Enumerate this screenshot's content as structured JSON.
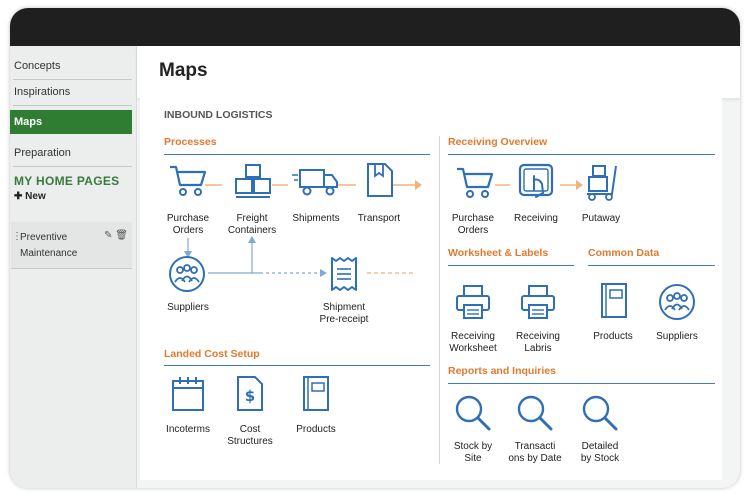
{
  "sidebar": {
    "items": [
      {
        "label": "Concepts"
      },
      {
        "label": "Inspirations"
      },
      {
        "label": "Maps"
      },
      {
        "label": "Preparation"
      }
    ],
    "home_title": "MY HOME PAGES",
    "new_label": "New",
    "pages": [
      {
        "line1": "Preventive",
        "line2": "Maintenance"
      }
    ]
  },
  "header": {
    "title": "Maps"
  },
  "main": {
    "group_title": "INBOUND LOGISTICS",
    "processes": {
      "title": "Processes",
      "items": [
        {
          "line1": "Purchase",
          "line2": "Orders"
        },
        {
          "line1": "Freight",
          "line2": "Containers"
        },
        {
          "line1": "Shipments",
          "line2": ""
        },
        {
          "line1": "Transport",
          "line2": ""
        },
        {
          "line1": "Suppliers",
          "line2": ""
        },
        {
          "line1": "Shipment",
          "line2": "Pre-receipt"
        }
      ]
    },
    "landed_cost": {
      "title": "Landed Cost Setup",
      "items": [
        {
          "line1": "Incoterms",
          "line2": ""
        },
        {
          "line1": "Cost",
          "line2": "Structures"
        },
        {
          "line1": "Products",
          "line2": ""
        }
      ]
    },
    "receiving_overview": {
      "title": "Receiving Overview",
      "items": [
        {
          "line1": "Purchase",
          "line2": "Orders"
        },
        {
          "line1": "Receiving",
          "line2": ""
        },
        {
          "line1": "Putaway",
          "line2": ""
        }
      ]
    },
    "worksheet_labels": {
      "title": "Worksheet & Labels",
      "items": [
        {
          "line1": "Receiving",
          "line2": "Worksheet"
        },
        {
          "line1": "Receiving",
          "line2": "Labris"
        }
      ]
    },
    "common_data": {
      "title": "Common Data",
      "items": [
        {
          "line1": "Products",
          "line2": ""
        },
        {
          "line1": "Suppliers",
          "line2": ""
        }
      ]
    },
    "reports": {
      "title": "Reports and Inquiries",
      "items": [
        {
          "line1": "Stock by",
          "line2": "Site"
        },
        {
          "line1": "Transacti",
          "line2": "ons by Date"
        },
        {
          "line1": "Detailed",
          "line2": "by Stock"
        }
      ]
    }
  },
  "colors": {
    "accent_green": "#2e7d32",
    "icon_blue": "#2f6fb5",
    "section_orange": "#e07a2e",
    "rule_blue": "#3f7cc2"
  }
}
